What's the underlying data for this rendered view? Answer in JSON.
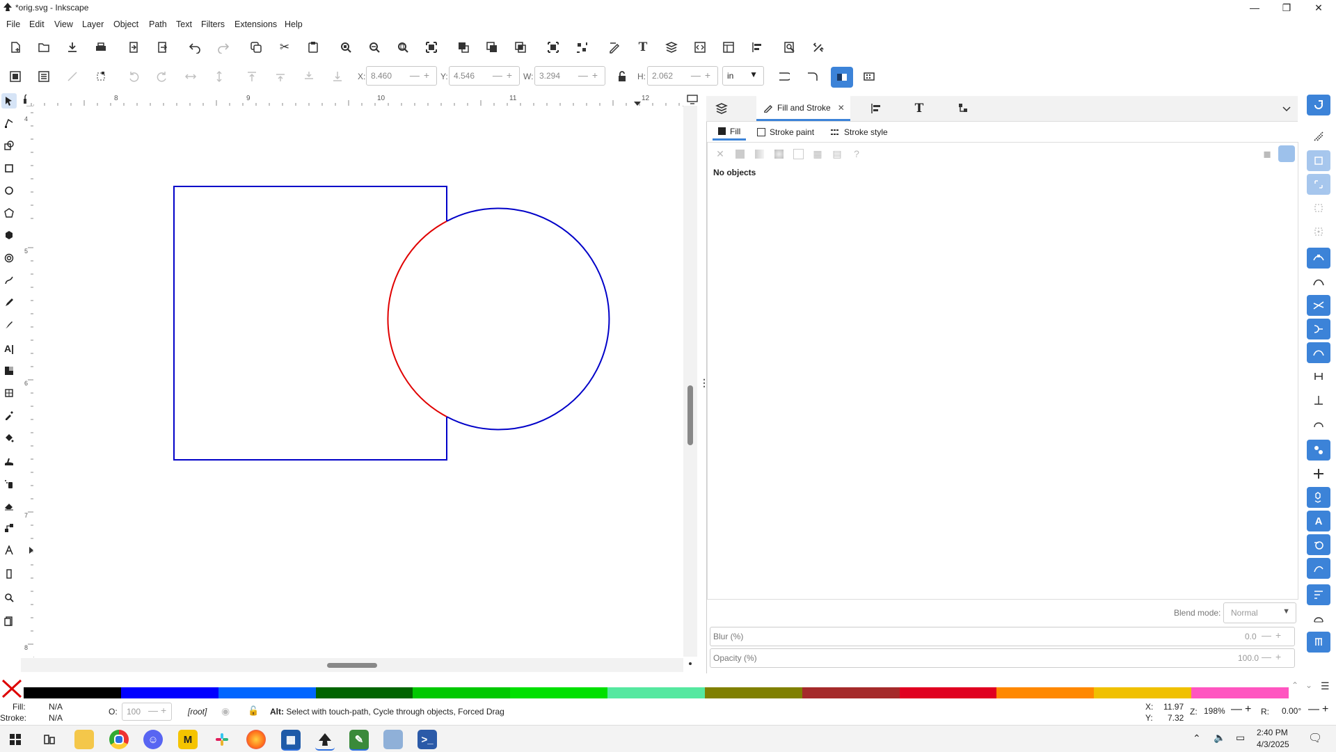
{
  "window": {
    "title": "*orig.svg - Inkscape",
    "minimize_icon": "minimize-icon",
    "restore_icon": "restore-icon",
    "close_icon": "close-icon"
  },
  "menu": {
    "items": [
      "File",
      "Edit",
      "View",
      "Layer",
      "Object",
      "Path",
      "Text",
      "Filters",
      "Extensions",
      "Help"
    ]
  },
  "commands_toolbar": {
    "icons": [
      "new-document-icon",
      "open-icon",
      "save-icon",
      "print-icon",
      "import-icon",
      "export-icon",
      "undo-icon",
      "redo-icon",
      "duplicate-icon",
      "cut-icon",
      "paste-icon",
      "zoom-selection-icon",
      "zoom-drawing-icon",
      "zoom-page-icon",
      "zoom-center-page-icon",
      "group-icon",
      "ungroup-icon",
      "ungroup-all-icon",
      "enter-group-icon",
      "exit-group-icon",
      "fill-stroke-icon",
      "text-font-icon",
      "layers-objects-icon",
      "xml-editor-icon",
      "document-properties-icon",
      "align-distribute-icon",
      "find-replace-icon",
      "preferences-icon"
    ]
  },
  "tool_controls": {
    "x_label": "X:",
    "x_value": "8.460",
    "y_label": "Y:",
    "y_value": "4.546",
    "w_label": "W:",
    "w_value": "3.294",
    "h_label": "H:",
    "h_value": "2.062",
    "unit": "in",
    "lock_icon": "lock-icon"
  },
  "toolbox": {
    "tools": [
      "selector-tool-icon",
      "node-tool-icon",
      "shapes-tool-icon",
      "rectangle-tool-icon",
      "ellipse-tool-icon",
      "star-polygon-tool-icon",
      "3d-box-tool-icon",
      "spiral-tool-icon",
      "bezier-pen-tool-icon",
      "pencil-tool-icon",
      "calligraphy-tool-icon",
      "text-tool-icon",
      "gradient-tool-icon",
      "mesh-tool-icon",
      "dropper-tool-icon",
      "paint-bucket-tool-icon",
      "tweak-tool-icon",
      "spray-tool-icon",
      "eraser-tool-icon",
      "connector-tool-icon",
      "lpe-tool-icon",
      "measure-tool-icon",
      "zoom-tool-icon",
      "pages-tool-icon"
    ]
  },
  "ruler": {
    "top_labels": [
      "8",
      "9",
      "10",
      "11",
      "12"
    ],
    "left_labels": [
      "4",
      "5",
      "6",
      "7",
      "8"
    ]
  },
  "dock": {
    "tab_active_label": "Fill and Stroke",
    "subtabs": [
      "Fill",
      "Stroke paint",
      "Stroke style"
    ],
    "no_objects": "No objects",
    "blend_label": "Blend mode:",
    "blend_value": "Normal",
    "blur_label": "Blur (%)",
    "blur_value": "0.0",
    "opacity_label": "Opacity (%)",
    "opacity_value": "100.0"
  },
  "palette": {
    "colors": [
      "#000000",
      "#0000ff",
      "#0066ff",
      "#006400",
      "#00c800",
      "#00e000",
      "#55e8a0",
      "#808000",
      "#a52a2a",
      "#e00020",
      "#ff8800",
      "#f0c000",
      "#ff55c0"
    ]
  },
  "status": {
    "fill_label": "Fill:",
    "fill_value": "N/A",
    "stroke_label": "Stroke:",
    "stroke_value": "N/A",
    "opacity_label": "O:",
    "opacity_value": "100",
    "layer": "[root]",
    "message_bold": "Alt:",
    "message": " Select with touch-path, Cycle through objects, Forced Drag",
    "x_label": "X:",
    "x_value": "11.97",
    "y_label": "Y:",
    "y_value": "7.32",
    "zoom_label": "Z:",
    "zoom_value": "198%",
    "rotation_label": "R:",
    "rotation_value": "0.00°"
  },
  "taskbar": {
    "time": "2:40 PM",
    "date": "4/3/2025",
    "apps": [
      "windows-start-icon",
      "task-view-icon",
      "file-explorer-icon",
      "chrome-icon",
      "discord-icon",
      "m-app-icon",
      "slack-icon",
      "firefox-icon",
      "calculator-icon",
      "inkscape-icon",
      "notepad-icon",
      "photos-icon",
      "powershell-icon"
    ]
  },
  "colors": {
    "accent": "#3c83d8",
    "rect_stroke": "#0000c8",
    "circle_stroke_blue": "#0000c8",
    "circle_stroke_red": "#e00000"
  }
}
